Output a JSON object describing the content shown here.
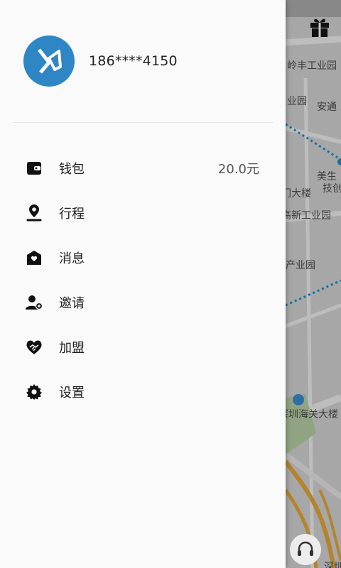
{
  "map": {
    "labels": [
      "岭丰工业园",
      "业园",
      "安通",
      "美生",
      "技创",
      "门大楼",
      "高新工业园",
      "产业园",
      "深圳海关大楼",
      "深圳"
    ]
  },
  "header_actions": {
    "gift_icon": "gift-icon",
    "support_icon": "headset-icon"
  },
  "user": {
    "avatar_icon": "app-logo-icon",
    "phone": "186****4150"
  },
  "menu": {
    "items": [
      {
        "icon": "wallet-icon",
        "label": "钱包",
        "value": "20.0元"
      },
      {
        "icon": "location-pin-icon",
        "label": "行程"
      },
      {
        "icon": "message-icon",
        "label": "消息"
      },
      {
        "icon": "add-user-icon",
        "label": "邀请"
      },
      {
        "icon": "handshake-heart-icon",
        "label": "加盟"
      },
      {
        "icon": "gear-icon",
        "label": "设置"
      }
    ]
  },
  "colors": {
    "accent": "#2f86c4",
    "drawer_bg": "#fafafa",
    "map_route": "#1e90c8"
  }
}
